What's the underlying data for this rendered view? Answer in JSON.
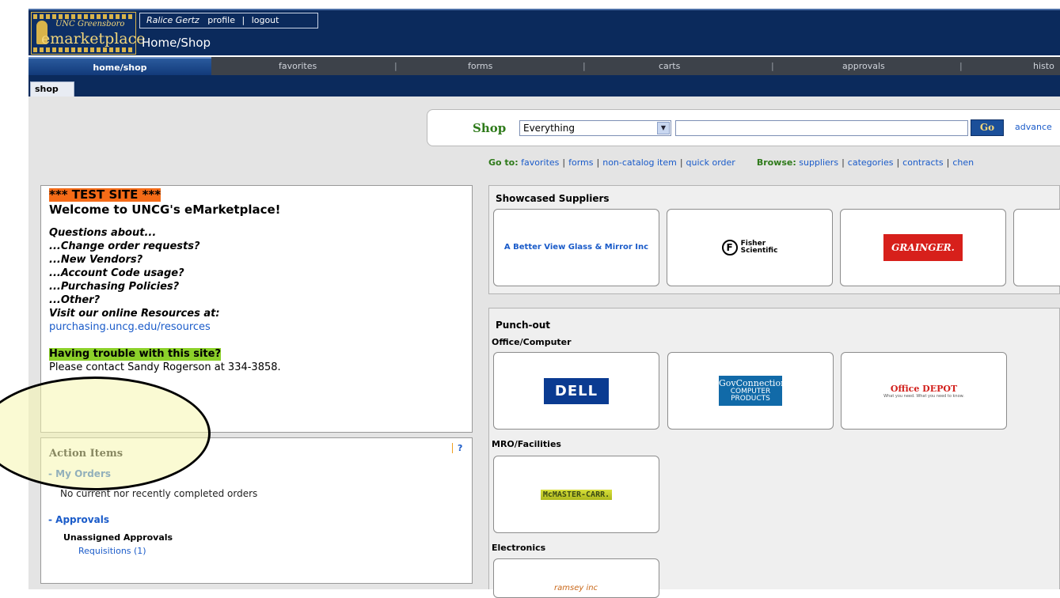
{
  "header": {
    "logo": {
      "org": "UNC Greensboro",
      "brand": "marketplace",
      "brand_initial": "e"
    },
    "user": {
      "name": "Ralice Gertz",
      "profile": "profile",
      "separator": "|",
      "logout": "logout"
    },
    "page_title": "Home/Shop"
  },
  "tabs": [
    {
      "label": "home/shop",
      "active": true
    },
    {
      "label": "favorites"
    },
    {
      "label": "forms"
    },
    {
      "label": "carts"
    },
    {
      "label": "approvals"
    },
    {
      "label": "histo"
    }
  ],
  "tab_divider": "|",
  "subtabs": [
    {
      "label": "shop"
    }
  ],
  "shop": {
    "label": "Shop",
    "scope_value": "Everything",
    "search_value": "",
    "go_label": "Go",
    "advanced_label": "advance"
  },
  "goto": {
    "label": "Go to:",
    "links": [
      "favorites",
      "forms",
      "non-catalog item",
      "quick order"
    ],
    "browse_label": "Browse:",
    "browse_links": [
      "suppliers",
      "categories",
      "contracts",
      "chen"
    ],
    "separator": "|"
  },
  "welcome": {
    "test_banner": "*** TEST SITE ***",
    "title": "Welcome to UNCG's eMarketplace!",
    "questions": [
      "Questions about...",
      "...Change order requests?",
      "...New Vendors?",
      "...Account Code usage?",
      "...Purchasing Policies?",
      "...Other?",
      "Visit our online Resources at:"
    ],
    "resource_link": "purchasing.uncg.edu/resources",
    "trouble": "Having trouble with this site?",
    "contact": "Please contact Sandy Rogerson at 334-3858."
  },
  "action_items": {
    "title": "Action Items",
    "help": "?",
    "my_orders": "- My Orders",
    "orders_empty": "No current nor recently completed orders",
    "approvals": "- Approvals",
    "unassigned": "Unassigned Approvals",
    "requisitions": "Requisitions (1)"
  },
  "showcased": {
    "title": "Showcased Suppliers",
    "suppliers": [
      {
        "name": "A Better View Glass & Mirror Inc"
      },
      {
        "name": "Fisher Scientific",
        "mark": "F",
        "line1": "Fisher",
        "line2": "Scientific"
      },
      {
        "name": "GRAINGER."
      }
    ]
  },
  "punchout": {
    "title": "Punch-out",
    "groups": [
      {
        "label": "Office/Computer",
        "suppliers": [
          {
            "name": "DELL"
          },
          {
            "name": "GovConnection",
            "sub1": "COMPUTER",
            "sub2": "PRODUCTS"
          },
          {
            "name": "Office DEPOT",
            "tagline": "What you need. What you need to know."
          }
        ]
      },
      {
        "label": "MRO/Facilities",
        "suppliers": [
          {
            "name": "McMASTER-CARR."
          }
        ]
      },
      {
        "label": "Electronics",
        "suppliers": [
          {
            "name": "ramsey inc"
          }
        ]
      }
    ]
  },
  "colors": {
    "header_bg": "#0b2a5c",
    "test_banner_bg": "#f56b17",
    "trouble_bg": "#8cd12a",
    "shop_green": "#2e7a1a",
    "link_blue": "#1a5bc9",
    "highlight_oval": "#f5f5af"
  },
  "icons": [
    "dropdown-arrow-icon",
    "help-icon",
    "spartan-helmet-icon"
  ]
}
